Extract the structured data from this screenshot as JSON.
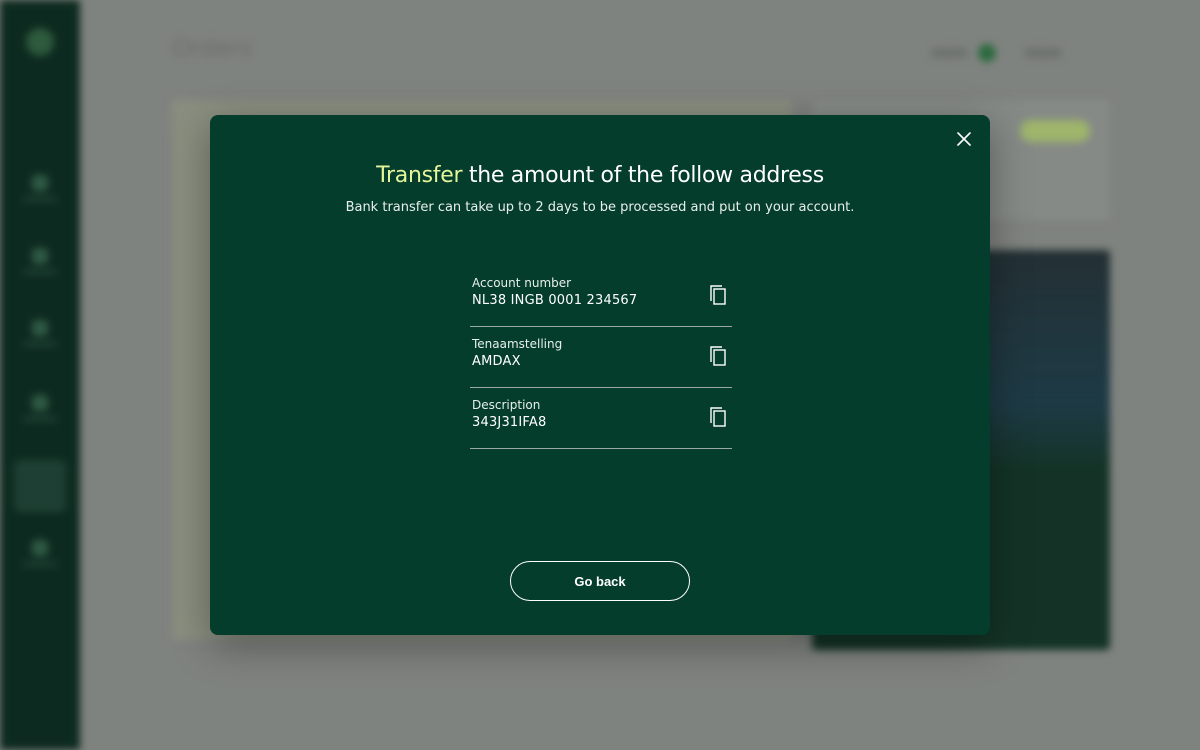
{
  "background": {
    "page_title": "Orders"
  },
  "modal": {
    "heading_highlight": "Transfer",
    "heading_rest": " the amount of the follow address",
    "subtitle": "Bank transfer can take up to 2 days to be processed and put on your account.",
    "fields": [
      {
        "label": "Account number",
        "value": "NL38 INGB 0001 234567"
      },
      {
        "label": "Tenaamstelling",
        "value": "AMDAX"
      },
      {
        "label": "Description",
        "value": "343J31IFA8"
      }
    ],
    "go_back_label": "Go back"
  },
  "icons": {
    "close": "close-icon",
    "copy": "copy-icon"
  },
  "colors": {
    "modal_bg": "#053d2d",
    "accent": "#e4f59a",
    "sidebar": "#0d2a20"
  }
}
